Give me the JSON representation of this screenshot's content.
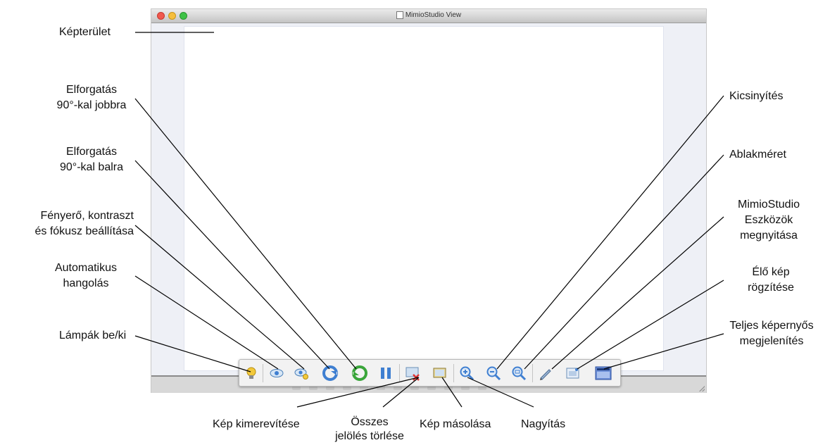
{
  "window": {
    "title": "MimioStudio View"
  },
  "labels": {
    "kepterulet": "Képterület",
    "elforgatas_jobbra": [
      "Elforgatás",
      "90°-kal jobbra"
    ],
    "elforgatas_balra": [
      "Elforgatás",
      "90°-kal balra"
    ],
    "fenyero": [
      "Fényerő, kontraszt",
      "és fókusz beállítása"
    ],
    "automatikus": [
      "Automatikus",
      "hangolás"
    ],
    "lampak": "Lámpák be/ki",
    "kicsinyites": "Kicsinyítés",
    "ablakmeret": "Ablakméret",
    "mimiostudio": [
      "MimioStudio",
      "Eszközök",
      "megnyitása"
    ],
    "elo_kep": [
      "Élő kép",
      "rögzítése"
    ],
    "teljes": [
      "Teljes képernyős",
      "megjelenítés"
    ],
    "kimerevites": "Kép kimerevítése",
    "osszes": [
      "Összes",
      "jelölés törlése"
    ],
    "masolasa": "Kép másolása",
    "nagyitas": "Nagyítás"
  },
  "toolbar": {
    "buttons": [
      {
        "name": "lamp-toggle-button",
        "icon": "lamp-icon"
      },
      {
        "name": "auto-tune-button",
        "icon": "eye-icon"
      },
      {
        "name": "brightness-contrast-focus-button",
        "icon": "eye-adjust-icon"
      },
      {
        "name": "rotate-left-button",
        "icon": "rotate-left-icon"
      },
      {
        "name": "rotate-right-button",
        "icon": "rotate-right-icon"
      },
      {
        "name": "freeze-image-button",
        "icon": "pause-icon"
      },
      {
        "name": "clear-annotations-button",
        "icon": "clear-image-icon"
      },
      {
        "name": "copy-image-button",
        "icon": "copy-image-icon"
      },
      {
        "name": "zoom-in-button",
        "icon": "zoom-in-icon"
      },
      {
        "name": "zoom-out-button",
        "icon": "zoom-out-icon"
      },
      {
        "name": "window-size-button",
        "icon": "zoom-fit-icon"
      },
      {
        "name": "open-mimiostudio-tools-button",
        "icon": "pen-icon"
      },
      {
        "name": "capture-live-image-button",
        "icon": "capture-icon"
      },
      {
        "name": "fullscreen-button",
        "icon": "fullscreen-icon"
      }
    ]
  },
  "colors": {
    "callout_line": "#000000",
    "toolbar_bg": "#f2f2f2",
    "accent_blue": "#3f7fd1",
    "accent_green": "#3aa53a"
  }
}
